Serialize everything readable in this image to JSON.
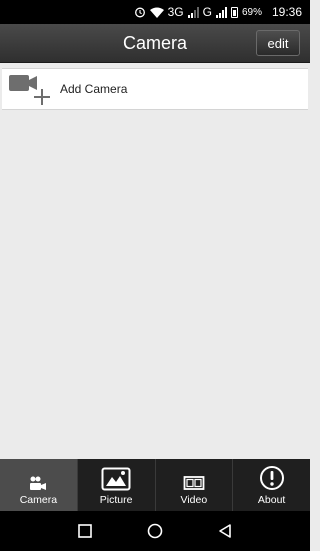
{
  "status_bar": {
    "network_1": "3G",
    "network_2": "G",
    "battery": "69%",
    "time": "19:36",
    "icons": [
      "alarm-icon",
      "wifi-icon",
      "signal-icon",
      "signal-icon",
      "battery-icon"
    ]
  },
  "header": {
    "title": "Camera",
    "edit_label": "edit"
  },
  "list": {
    "items": [
      {
        "label": "Add Camera",
        "icon": "add-camera-icon"
      }
    ]
  },
  "tabs": [
    {
      "label": "Camera",
      "icon": "camera-people-icon",
      "active": true
    },
    {
      "label": "Picture",
      "icon": "picture-icon",
      "active": false
    },
    {
      "label": "Video",
      "icon": "film-icon",
      "active": false
    },
    {
      "label": "About",
      "icon": "info-icon",
      "active": false
    }
  ],
  "nav": {
    "icons": [
      "recent-apps-icon",
      "home-icon",
      "back-icon"
    ]
  },
  "colors": {
    "header_bg": "#3a3a3a",
    "tab_bar_bg": "#1f1f1f",
    "tab_active_bg": "#4c4c4c",
    "content_bg": "#ebebeb"
  }
}
